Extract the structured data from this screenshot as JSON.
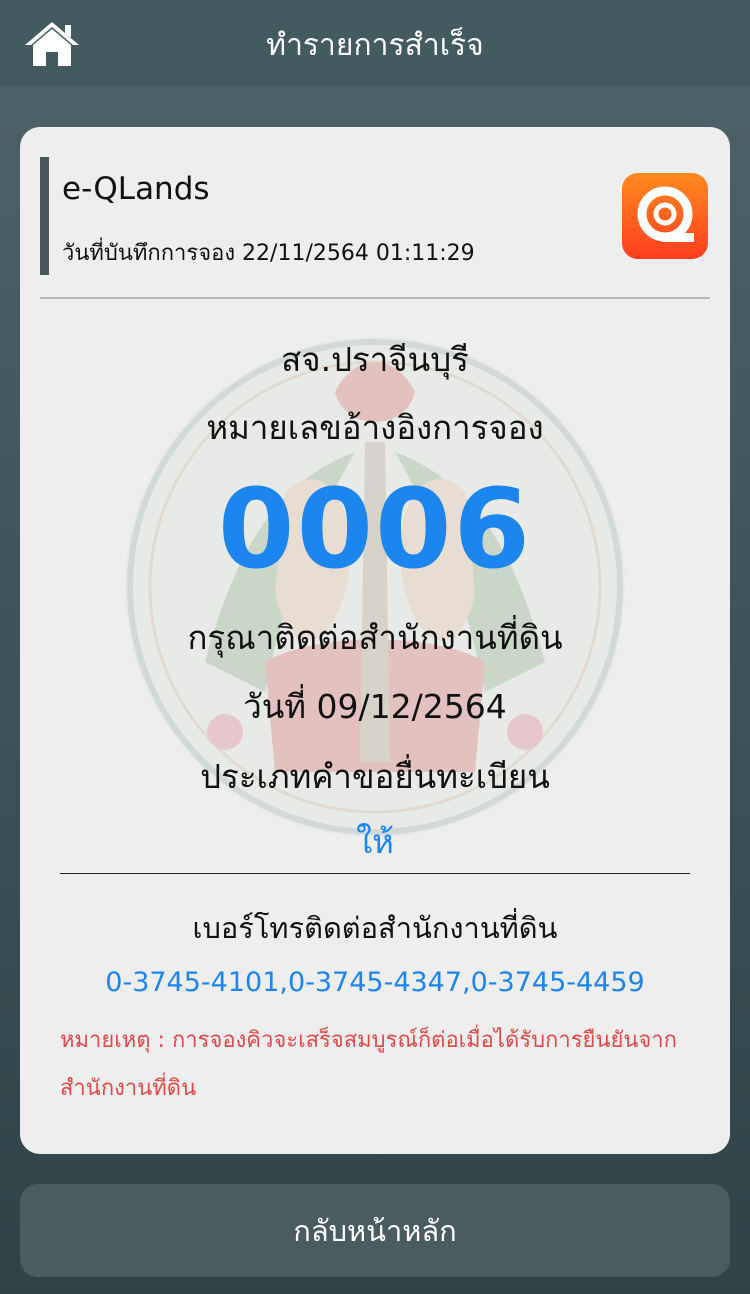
{
  "header": {
    "title": "ทำรายการสำเร็จ",
    "home_icon": "home-icon"
  },
  "card": {
    "app_name": "e-QLands",
    "booking_date": "วันที่บันทึกการจอง 22/11/2564 01:11:29",
    "logo_icon": "eqlands-logo-icon",
    "office": "สจ.ปราจีนบุรี",
    "ref_label": "หมายเลขอ้างอิงการจอง",
    "queue_number": "0006",
    "contact_office": "กรุณาติดต่อสำนักงานที่ดิน",
    "appointment_date": "วันที่ 09/12/2564",
    "request_type_label": "ประเภทคำขอยื่นทะเบียน",
    "request_type_value": "ให้",
    "phone_label": "เบอร์โทรติดต่อสำนักงานที่ดิน",
    "phone_numbers": "0-3745-4101,0-3745-4347,0-3745-4459",
    "note": "หมายเหตุ : การจองคิวจะเสร็จสมบูรณ์ก็ต่อเมื่อได้รับการยืนยันจากสำนักงานที่ดิน"
  },
  "footer": {
    "back_label": "กลับหน้าหลัก"
  },
  "colors": {
    "accent_blue": "#1c85ee",
    "note_red": "#e04a49",
    "logo_orange": "#ff5a1f"
  }
}
